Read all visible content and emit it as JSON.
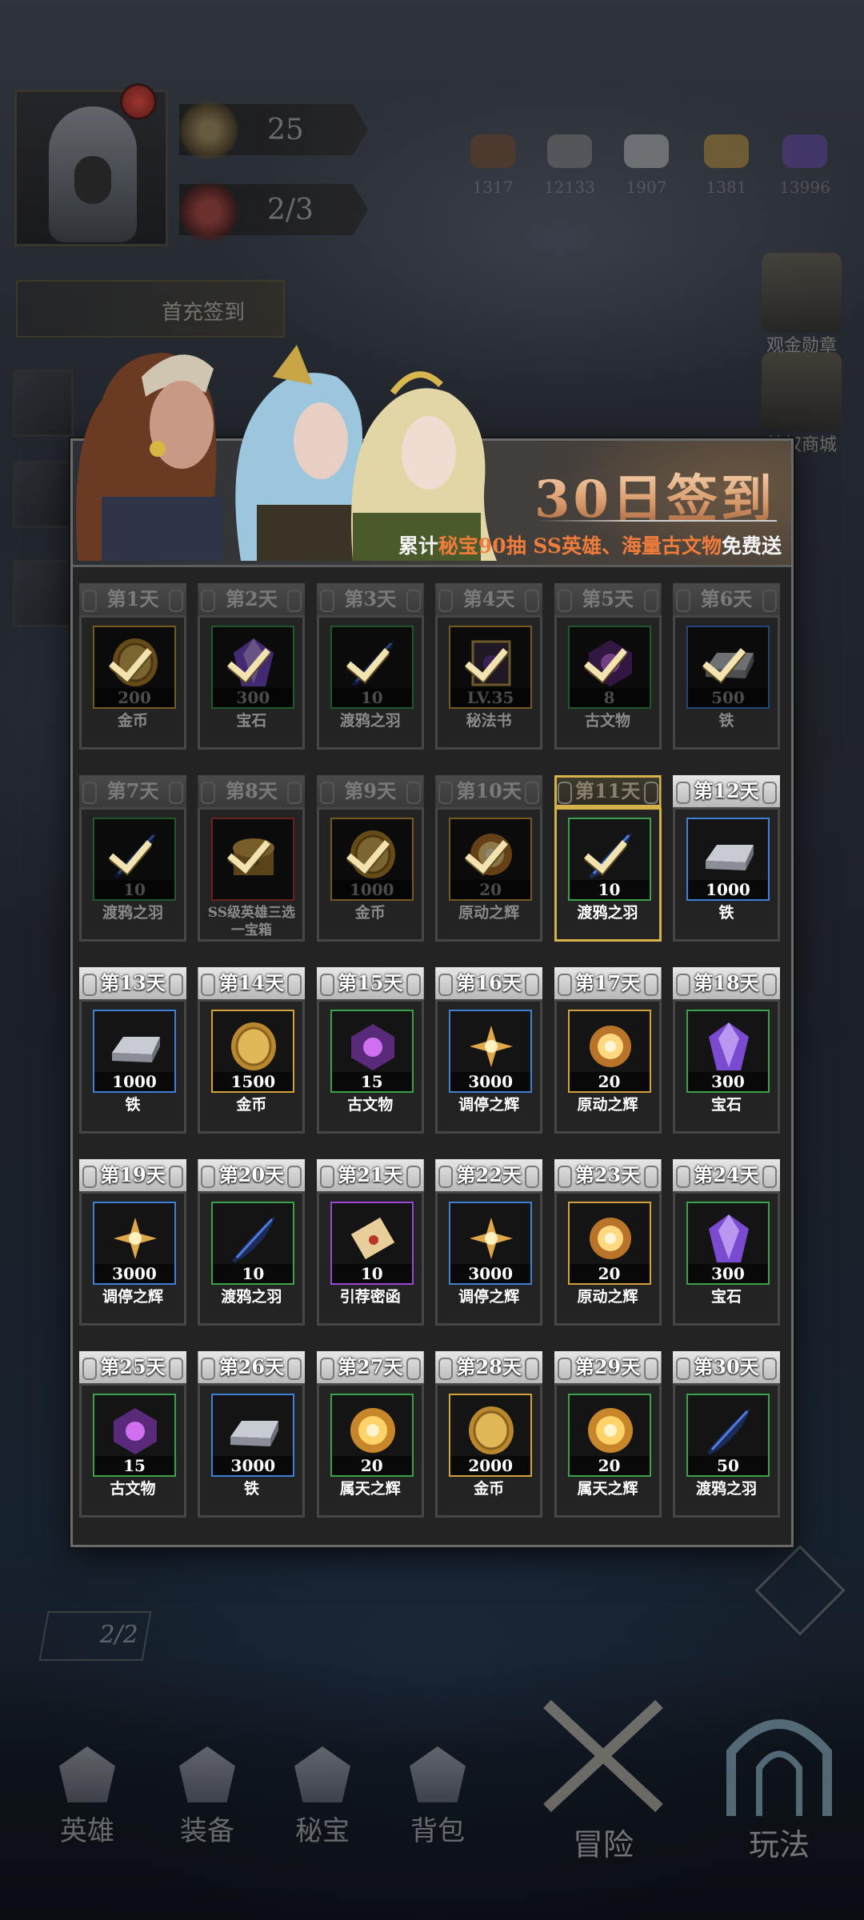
{
  "hud": {
    "level": "25",
    "stamina": "2/3",
    "first_pay": "首充签到",
    "resources": [
      "1317",
      "12133",
      "1907",
      "1381",
      "13996"
    ],
    "right_entries": [
      "观金勋章",
      "特权商城"
    ],
    "pvp_count": "2/2"
  },
  "panel": {
    "title": "30日签到",
    "subtitle_pre": "累计",
    "subtitle_hl1": "秘宝90抽",
    "subtitle_hl2": "SS英雄、海量古文物",
    "subtitle_post": "免费送"
  },
  "days": [
    {
      "day": "第1天",
      "qty": "200",
      "name": "金币",
      "icon": "gold-coin-icon",
      "rarity": "gold",
      "state": "done"
    },
    {
      "day": "第2天",
      "qty": "300",
      "name": "宝石",
      "icon": "gem-icon",
      "rarity": "green",
      "state": "done"
    },
    {
      "day": "第3天",
      "qty": "10",
      "name": "渡鸦之羽",
      "icon": "raven-feather-icon",
      "rarity": "green",
      "state": "done"
    },
    {
      "day": "第4天",
      "qty": "LV.35",
      "name": "秘法书",
      "icon": "spellbook-icon",
      "rarity": "gold",
      "state": "done"
    },
    {
      "day": "第5天",
      "qty": "8",
      "name": "古文物",
      "icon": "artifact-icon",
      "rarity": "green",
      "state": "done"
    },
    {
      "day": "第6天",
      "qty": "500",
      "name": "铁",
      "icon": "iron-ingot-icon",
      "rarity": "blue",
      "state": "done"
    },
    {
      "day": "第7天",
      "qty": "10",
      "name": "渡鸦之羽",
      "icon": "raven-feather-icon",
      "rarity": "green",
      "state": "done"
    },
    {
      "day": "第8天",
      "qty": "",
      "name": "SS级英雄三选一宝箱",
      "icon": "hero-chest-icon",
      "rarity": "red",
      "state": "done"
    },
    {
      "day": "第9天",
      "qty": "1000",
      "name": "金币",
      "icon": "gold-coin-icon",
      "rarity": "gold",
      "state": "done"
    },
    {
      "day": "第10天",
      "qty": "20",
      "name": "原动之辉",
      "icon": "prime-radiance-icon",
      "rarity": "gold",
      "state": "done"
    },
    {
      "day": "第11天",
      "qty": "10",
      "name": "渡鸦之羽",
      "icon": "raven-feather-icon",
      "rarity": "green",
      "state": "current"
    },
    {
      "day": "第12天",
      "qty": "1000",
      "name": "铁",
      "icon": "iron-ingot-icon",
      "rarity": "blue",
      "state": "future"
    },
    {
      "day": "第13天",
      "qty": "1000",
      "name": "铁",
      "icon": "iron-ingot-icon",
      "rarity": "blue",
      "state": "future"
    },
    {
      "day": "第14天",
      "qty": "1500",
      "name": "金币",
      "icon": "gold-coin-icon",
      "rarity": "gold",
      "state": "future"
    },
    {
      "day": "第15天",
      "qty": "15",
      "name": "古文物",
      "icon": "artifact-icon",
      "rarity": "green",
      "state": "future"
    },
    {
      "day": "第16天",
      "qty": "3000",
      "name": "调停之辉",
      "icon": "mediation-radiance-icon",
      "rarity": "blue",
      "state": "future"
    },
    {
      "day": "第17天",
      "qty": "20",
      "name": "原动之辉",
      "icon": "prime-radiance-icon",
      "rarity": "gold",
      "state": "future"
    },
    {
      "day": "第18天",
      "qty": "300",
      "name": "宝石",
      "icon": "gem-icon",
      "rarity": "green",
      "state": "future"
    },
    {
      "day": "第19天",
      "qty": "3000",
      "name": "调停之辉",
      "icon": "mediation-radiance-icon",
      "rarity": "blue",
      "state": "future"
    },
    {
      "day": "第20天",
      "qty": "10",
      "name": "渡鸦之羽",
      "icon": "raven-feather-icon",
      "rarity": "green",
      "state": "future"
    },
    {
      "day": "第21天",
      "qty": "10",
      "name": "引荐密函",
      "icon": "scroll-icon",
      "rarity": "purple",
      "state": "future"
    },
    {
      "day": "第22天",
      "qty": "3000",
      "name": "调停之辉",
      "icon": "mediation-radiance-icon",
      "rarity": "blue",
      "state": "future"
    },
    {
      "day": "第23天",
      "qty": "20",
      "name": "原动之辉",
      "icon": "prime-radiance-icon",
      "rarity": "gold",
      "state": "future"
    },
    {
      "day": "第24天",
      "qty": "300",
      "name": "宝石",
      "icon": "gem-icon",
      "rarity": "green",
      "state": "future"
    },
    {
      "day": "第25天",
      "qty": "15",
      "name": "古文物",
      "icon": "artifact-icon",
      "rarity": "green",
      "state": "future"
    },
    {
      "day": "第26天",
      "qty": "3000",
      "name": "铁",
      "icon": "iron-ingot-icon",
      "rarity": "blue",
      "state": "future"
    },
    {
      "day": "第27天",
      "qty": "20",
      "name": "属天之辉",
      "icon": "celestial-radiance-icon",
      "rarity": "green",
      "state": "future"
    },
    {
      "day": "第28天",
      "qty": "2000",
      "name": "金币",
      "icon": "gold-coin-icon",
      "rarity": "gold",
      "state": "future"
    },
    {
      "day": "第29天",
      "qty": "20",
      "name": "属天之辉",
      "icon": "celestial-radiance-icon",
      "rarity": "green",
      "state": "future"
    },
    {
      "day": "第30天",
      "qty": "50",
      "name": "渡鸦之羽",
      "icon": "raven-feather-icon",
      "rarity": "green",
      "state": "future"
    }
  ],
  "nav": {
    "heroes": "英雄",
    "equipment": "装备",
    "treasure": "秘宝",
    "backpack": "背包",
    "adventure": "冒险",
    "battle": "玩法"
  }
}
